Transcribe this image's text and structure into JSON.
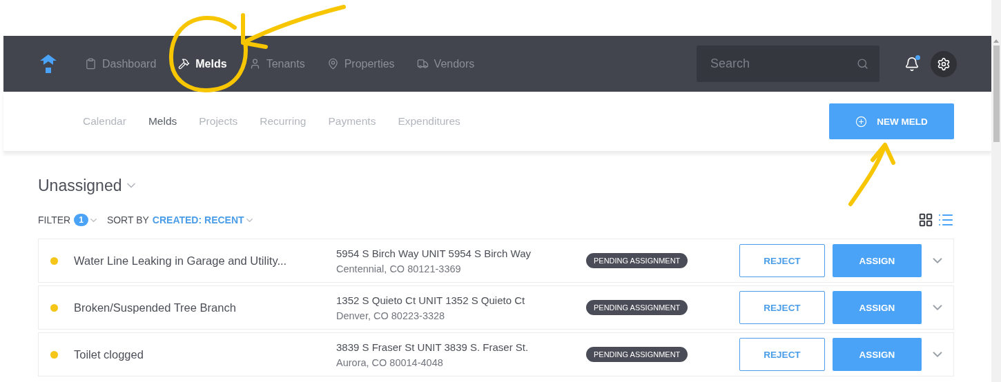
{
  "nav": {
    "items": [
      {
        "label": "Dashboard",
        "kind": "clipboard",
        "selected": false
      },
      {
        "label": "Melds",
        "kind": "tools",
        "selected": true
      },
      {
        "label": "Tenants",
        "kind": "user",
        "selected": false
      },
      {
        "label": "Properties",
        "kind": "pin",
        "selected": false
      },
      {
        "label": "Vendors",
        "kind": "truck",
        "selected": false
      }
    ]
  },
  "search": {
    "placeholder": "Search"
  },
  "notifications": {
    "unread": true
  },
  "subnav": {
    "tabs": [
      {
        "label": "Calendar",
        "selected": false
      },
      {
        "label": "Melds",
        "selected": true
      },
      {
        "label": "Projects",
        "selected": false
      },
      {
        "label": "Recurring",
        "selected": false
      },
      {
        "label": "Payments",
        "selected": false
      },
      {
        "label": "Expenditures",
        "selected": false
      }
    ]
  },
  "new_button": {
    "label": "NEW MELD"
  },
  "list_title": "Unassigned",
  "filter": {
    "label": "FILTER",
    "count": "1"
  },
  "sort": {
    "label": "SORT BY",
    "value": "CREATED: RECENT"
  },
  "view_modes": [
    {
      "kind": "grid",
      "selected": false
    },
    {
      "kind": "list",
      "selected": true
    }
  ],
  "melds": [
    {
      "title": "Water Line Leaking in Garage and Utility...",
      "color": "#f5c518",
      "address_line1": "5954 S Birch Way UNIT 5954 S Birch Way",
      "address_line2": "Centennial, CO 80121-3369",
      "status": "PENDING ASSIGNMENT",
      "reject_label": "REJECT",
      "assign_label": "ASSIGN"
    },
    {
      "title": "Broken/Suspended Tree Branch",
      "color": "#f5c518",
      "address_line1": "1352 S Quieto Ct UNIT 1352 S Quieto Ct",
      "address_line2": "Denver, CO 80223-3328",
      "status": "PENDING ASSIGNMENT",
      "reject_label": "REJECT",
      "assign_label": "ASSIGN"
    },
    {
      "title": "Toilet clogged",
      "color": "#f5c518",
      "address_line1": "3839 S Fraser St UNIT 3839 S. Fraser St.",
      "address_line2": "Aurora, CO 80014-4048",
      "status": "PENDING ASSIGNMENT",
      "reject_label": "REJECT",
      "assign_label": "ASSIGN"
    }
  ]
}
